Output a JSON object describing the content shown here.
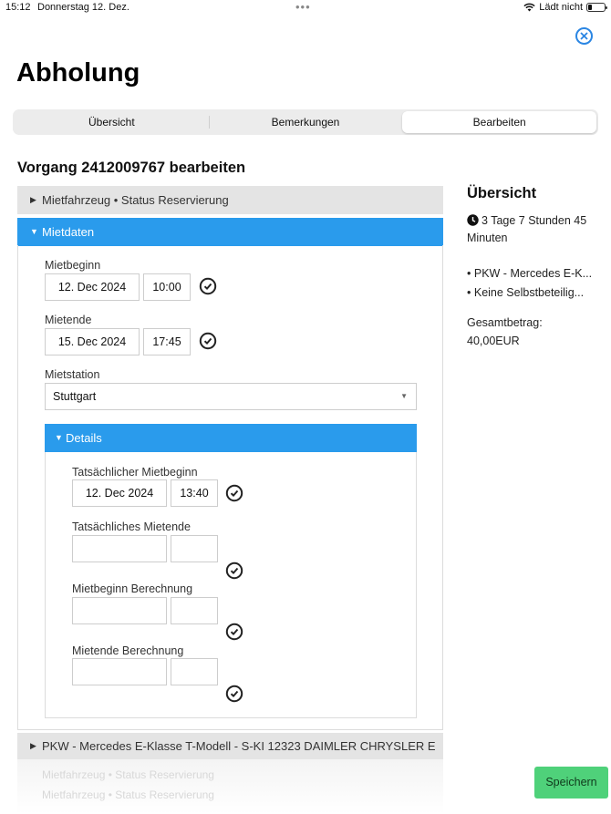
{
  "statusbar": {
    "time": "15:12",
    "date": "Donnerstag 12. Dez.",
    "dots": "•••",
    "charging": "Lädt nicht"
  },
  "page": {
    "title": "Abholung"
  },
  "tabs": [
    {
      "label": "Übersicht",
      "active": false
    },
    {
      "label": "Bemerkungen",
      "active": false
    },
    {
      "label": "Bearbeiten",
      "active": true
    }
  ],
  "section_title": "Vorgang 2412009767 bearbeiten",
  "accordion": {
    "vehicle_status": "Mietfahrzeug • Status Reservierung",
    "mietdaten": "Mietdaten"
  },
  "mietdaten": {
    "mietbeginn_label": "Mietbeginn",
    "mietbeginn_date": "12. Dec 2024",
    "mietbeginn_time": "10:00",
    "mietende_label": "Mietende",
    "mietende_date": "15. Dec 2024",
    "mietende_time": "17:45",
    "station_label": "Mietstation",
    "station_value": "Stuttgart"
  },
  "details": {
    "header": "Details",
    "actual_start_label": "Tatsächlicher Mietbeginn",
    "actual_start_date": "12. Dec 2024",
    "actual_start_time": "13:40",
    "actual_end_label": "Tatsächliches Mietende",
    "actual_end_date": "",
    "actual_end_time": "",
    "calc_start_label": "Mietbeginn Berechnung",
    "calc_start_date": "",
    "calc_start_time": "",
    "calc_end_label": "Mietende Berechnung",
    "calc_end_date": "",
    "calc_end_time": ""
  },
  "summary": {
    "title": "Übersicht",
    "duration": "3 Tage 7 Stunden 45 Minuten",
    "items": [
      "PKW - Mercedes E-K...",
      "Keine Selbstbeteilig..."
    ],
    "total_label": "Gesamtbetrag:",
    "total_value": "40,00EUR"
  },
  "vehicle_row": "PKW - Mercedes E-Klasse T-Modell - S-KI 12323 DAIMLER CHRYSLER E",
  "ghost_rows": [
    "Mietfahrzeug • Status Reservierung",
    "Mietfahrzeug • Status Reservierung"
  ],
  "actions": {
    "save": "Speichern"
  },
  "colors": {
    "accent_blue": "#2a9bec",
    "save_green": "#4fd17a",
    "close_blue": "#2b86e3"
  }
}
